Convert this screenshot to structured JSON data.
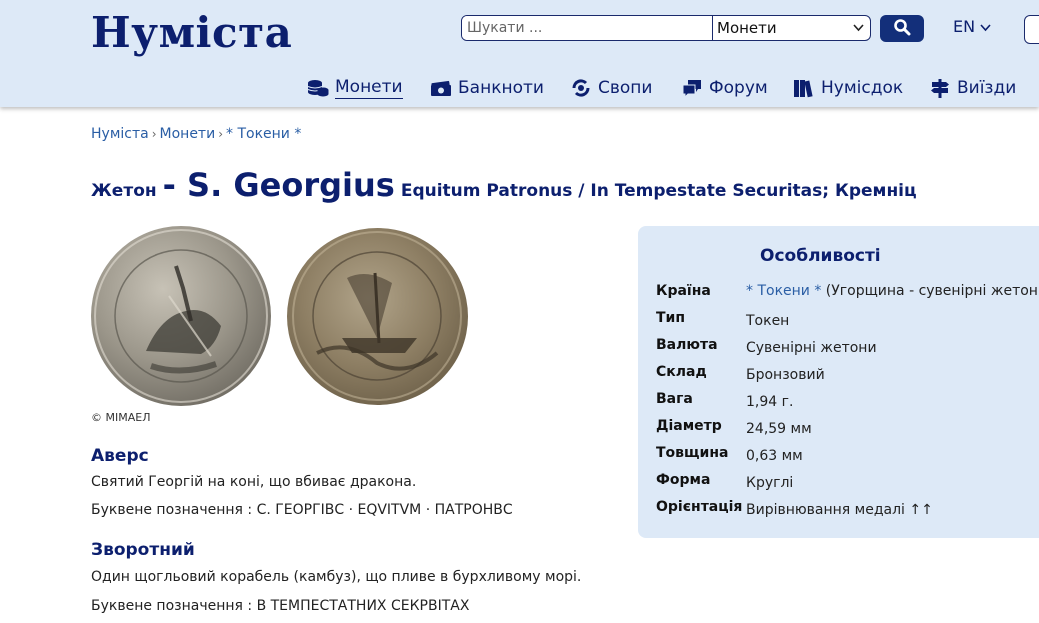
{
  "header": {
    "logo": "Нуміста",
    "search_placeholder": "Шукати ...",
    "search_category": "Монети",
    "language": "EN"
  },
  "nav": [
    {
      "label": "Монети",
      "icon": "coins-icon"
    },
    {
      "label": "Банкноти",
      "icon": "banknote-icon"
    },
    {
      "label": "Свопи",
      "icon": "swap-icon"
    },
    {
      "label": "Форум",
      "icon": "forum-icon"
    },
    {
      "label": "Нумісдок",
      "icon": "books-icon"
    },
    {
      "label": "Виїзди",
      "icon": "signpost-icon"
    }
  ],
  "breadcrumb": [
    "Нуміста",
    "Монети",
    "* Токени *"
  ],
  "title": {
    "type": "Жетон",
    "name": "- S. Georgius",
    "subtitle": "Equitum Patronus / In Tempestate Securitas; Кремніц"
  },
  "image_credit": "© MIMAEЛ",
  "obverse": {
    "heading": "Аверс",
    "description": "Святий Георгій на коні, що вбиває дракона.",
    "lettering_label": "Буквене позначення :",
    "lettering": "С. ГЕОРГІВС · EQVITVM · ПАТРОНВС"
  },
  "reverse": {
    "heading": "Зворотний",
    "description": "Один щогльовий корабель (камбуз), що пливе в бурхливому морі.",
    "lettering_label": "Буквене позначення :",
    "lettering": "В ТЕМПЕСТАТНИХ СЕКРВІТАХ"
  },
  "features": {
    "heading": "Особливості",
    "rows": [
      {
        "key": "Країна",
        "link": "* Токени *",
        "value": "(Угорщина - сувенірні жетони)"
      },
      {
        "key": "Тип",
        "value": "Токен"
      },
      {
        "key": "Валюта",
        "value": "Сувенірні жетони"
      },
      {
        "key": "Склад",
        "value": "Бронзовий"
      },
      {
        "key": "Вага",
        "value": "1,94 г."
      },
      {
        "key": "Діаметр",
        "value": "24,59 мм"
      },
      {
        "key": "Товщина",
        "value": "0,63 мм"
      },
      {
        "key": "Форма",
        "value": "Круглі"
      },
      {
        "key": "Орієнтація",
        "value": "Вирівнювання медалі ↑↑"
      }
    ]
  }
}
